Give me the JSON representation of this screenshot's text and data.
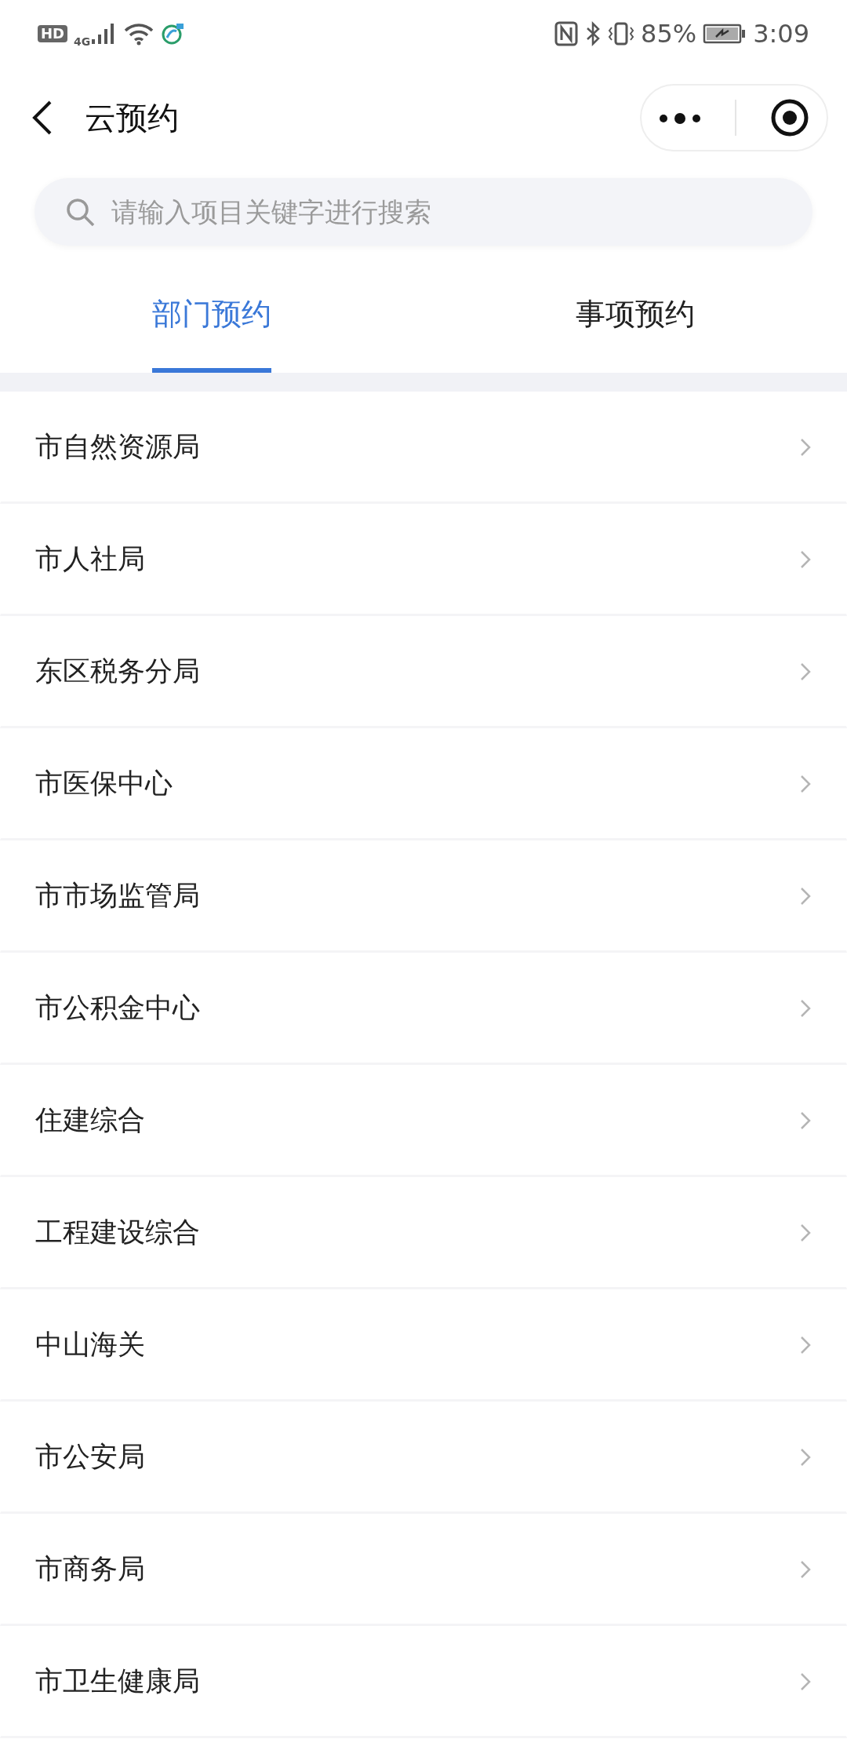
{
  "status_bar": {
    "hd": "HD",
    "network": "4G",
    "battery_percent": "85%",
    "time": "3:09"
  },
  "header": {
    "title": "云预约"
  },
  "search": {
    "placeholder": "请输入项目关键字进行搜索"
  },
  "tabs": [
    {
      "label": "部门预约",
      "selected": true
    },
    {
      "label": "事项预约",
      "selected": false
    }
  ],
  "departments": [
    {
      "name": "市自然资源局"
    },
    {
      "name": "市人社局"
    },
    {
      "name": "东区税务分局"
    },
    {
      "name": "市医保中心"
    },
    {
      "name": "市市场监管局"
    },
    {
      "name": "市公积金中心"
    },
    {
      "name": "住建综合"
    },
    {
      "name": "工程建设综合"
    },
    {
      "name": "中山海关"
    },
    {
      "name": "市公安局"
    },
    {
      "name": "市商务局"
    },
    {
      "name": "市卫生健康局"
    }
  ]
}
